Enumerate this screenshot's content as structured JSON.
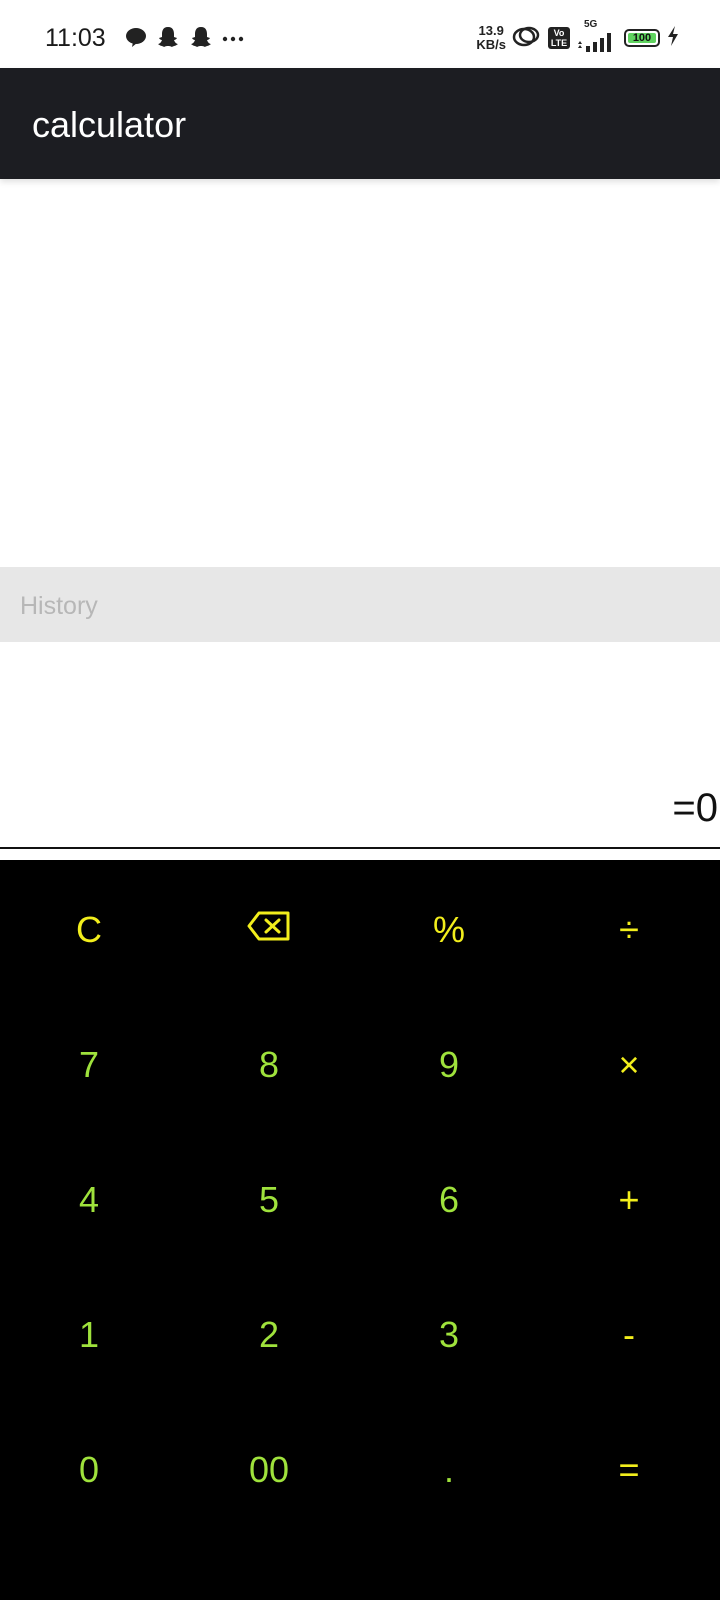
{
  "status_bar": {
    "time": "11:03",
    "speed_value": "13.9",
    "speed_unit": "KB/s",
    "volte_top": "Vo",
    "volte_bottom": "LTE",
    "network": "5G",
    "battery": "100"
  },
  "app_bar": {
    "title": "calculator"
  },
  "history": {
    "label": "History"
  },
  "display": {
    "result": "=0"
  },
  "keypad": {
    "rows": [
      [
        "C",
        "⌫",
        "%",
        "÷"
      ],
      [
        "7",
        "8",
        "9",
        "×"
      ],
      [
        "4",
        "5",
        "6",
        "+"
      ],
      [
        "1",
        "2",
        "3",
        "-"
      ],
      [
        "0",
        "00",
        ".",
        "="
      ]
    ]
  },
  "colors": {
    "operator": "#f2ee1c",
    "digit": "#9fe23c",
    "keypad_bg": "#000000",
    "appbar_bg": "#1c1d22"
  }
}
